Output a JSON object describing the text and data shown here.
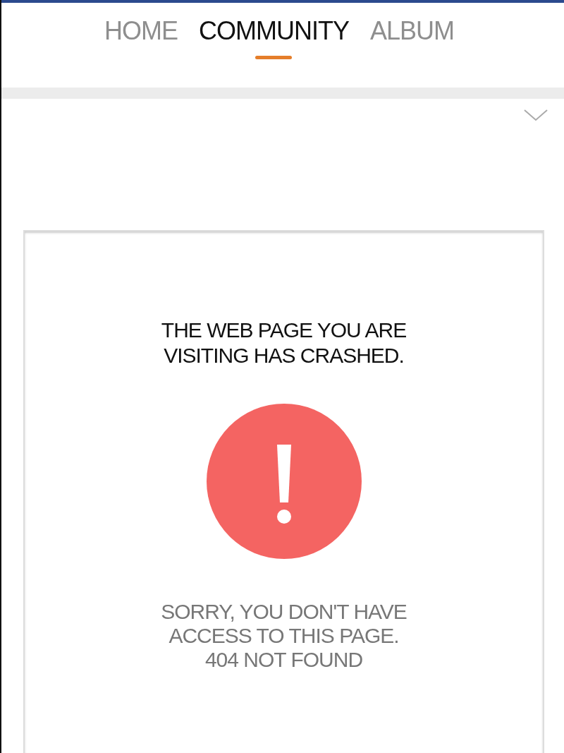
{
  "tabs": [
    {
      "label": "HOME",
      "selected": false
    },
    {
      "label": "COMMUNITY",
      "selected": true
    },
    {
      "label": "ALBUM",
      "selected": false
    }
  ],
  "error_card": {
    "heading": "THE WEB PAGE YOU ARE VISITING HAS CRASHED.",
    "message": "SORRY, YOU DON'T HAVE ACCESS TO THIS PAGE. 404 NOT FOUND"
  }
}
